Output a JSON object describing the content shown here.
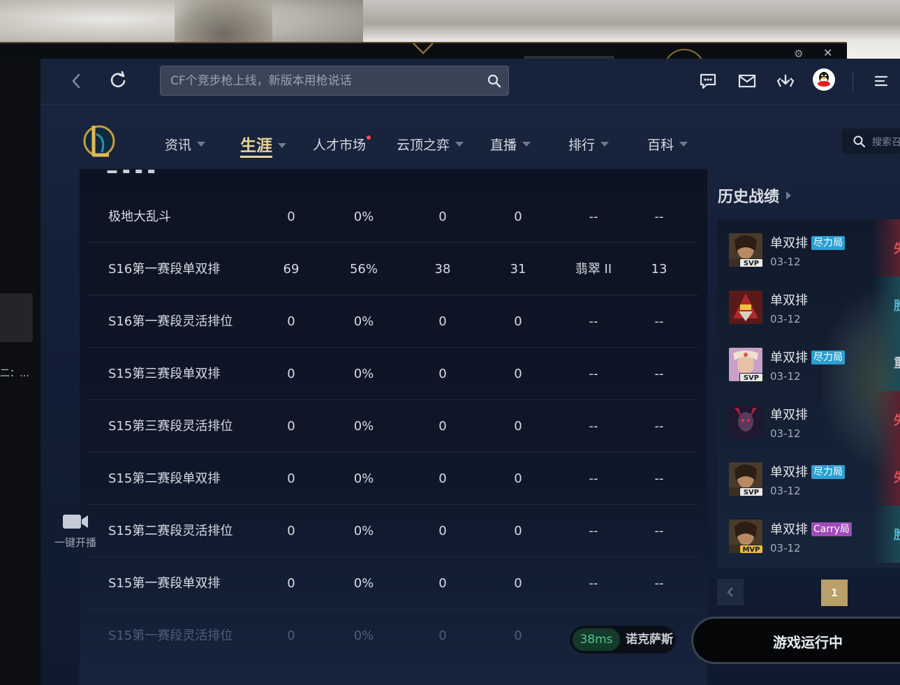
{
  "topbar": {
    "search_placeholder": "CF个竞步枪上线，新版本用枪说话"
  },
  "left_panel": {
    "truncated_text": "二：…"
  },
  "nav": {
    "items": [
      {
        "label": "资讯",
        "caret": true
      },
      {
        "label": "生涯",
        "caret": true,
        "active": true
      },
      {
        "label": "人才市场",
        "dot": true
      },
      {
        "label": "云顶之弈",
        "caret": true
      },
      {
        "label": "直播",
        "caret": true
      },
      {
        "label": "排行",
        "caret": true
      },
      {
        "label": "百科",
        "caret": true
      }
    ],
    "search_placeholder": "搜索召"
  },
  "stats": {
    "rows": [
      {
        "name": "极地大乱斗",
        "games": "0",
        "winrate": "0%",
        "wins": "0",
        "losses": "0",
        "rank": "--",
        "points": "--"
      },
      {
        "name": "S16第一赛段单双排",
        "games": "69",
        "winrate": "56%",
        "wins": "38",
        "losses": "31",
        "rank": "翡翠 II",
        "points": "13"
      },
      {
        "name": "S16第一赛段灵活排位",
        "games": "0",
        "winrate": "0%",
        "wins": "0",
        "losses": "0",
        "rank": "--",
        "points": "--"
      },
      {
        "name": "S15第三赛段单双排",
        "games": "0",
        "winrate": "0%",
        "wins": "0",
        "losses": "0",
        "rank": "--",
        "points": "--"
      },
      {
        "name": "S15第三赛段灵活排位",
        "games": "0",
        "winrate": "0%",
        "wins": "0",
        "losses": "0",
        "rank": "--",
        "points": "--"
      },
      {
        "name": "S15第二赛段单双排",
        "games": "0",
        "winrate": "0%",
        "wins": "0",
        "losses": "0",
        "rank": "--",
        "points": "--"
      },
      {
        "name": "S15第二赛段灵活排位",
        "games": "0",
        "winrate": "0%",
        "wins": "0",
        "losses": "0",
        "rank": "--",
        "points": "--"
      },
      {
        "name": "S15第一赛段单双排",
        "games": "0",
        "winrate": "0%",
        "wins": "0",
        "losses": "0",
        "rank": "--",
        "points": "--"
      },
      {
        "name": "S15第一赛段灵活排位",
        "games": "0",
        "winrate": "0%",
        "wins": "0",
        "losses": "0",
        "rank": "--",
        "points": "--"
      }
    ]
  },
  "live": {
    "label": "一键开播"
  },
  "history": {
    "title": "历史战绩",
    "matches": [
      {
        "mode": "单双排",
        "tag": "尽力局",
        "badge": "SVP",
        "date": "03-12",
        "result": "失",
        "outcome": "lose"
      },
      {
        "mode": "单双排",
        "tag": "",
        "badge": "",
        "date": "03-12",
        "result": "胜",
        "outcome": "win"
      },
      {
        "mode": "单双排",
        "tag": "尽力局",
        "badge": "SVP",
        "date": "03-12",
        "result": "重",
        "outcome": "win"
      },
      {
        "mode": "单双排",
        "tag": "",
        "badge": "",
        "date": "03-12",
        "result": "失",
        "outcome": "lose"
      },
      {
        "mode": "单双排",
        "tag": "尽力局",
        "badge": "SVP",
        "date": "03-12",
        "result": "失",
        "outcome": "lose"
      },
      {
        "mode": "单双排",
        "tag": "Carry局",
        "badge": "MVP",
        "date": "03-12",
        "result": "胜",
        "outcome": "win"
      }
    ],
    "page": "1"
  },
  "status": {
    "ping": "38ms",
    "server": "诺克萨斯",
    "play_button": "游戏运行中"
  },
  "colors": {
    "accent_gold": "#e9d39a",
    "ping_green": "#52c58a",
    "tag_effort": "#2b9fd1",
    "tag_carry": "#a04bb8",
    "lose_red": "#e0505a",
    "win_teal": "#4fb7d0"
  }
}
